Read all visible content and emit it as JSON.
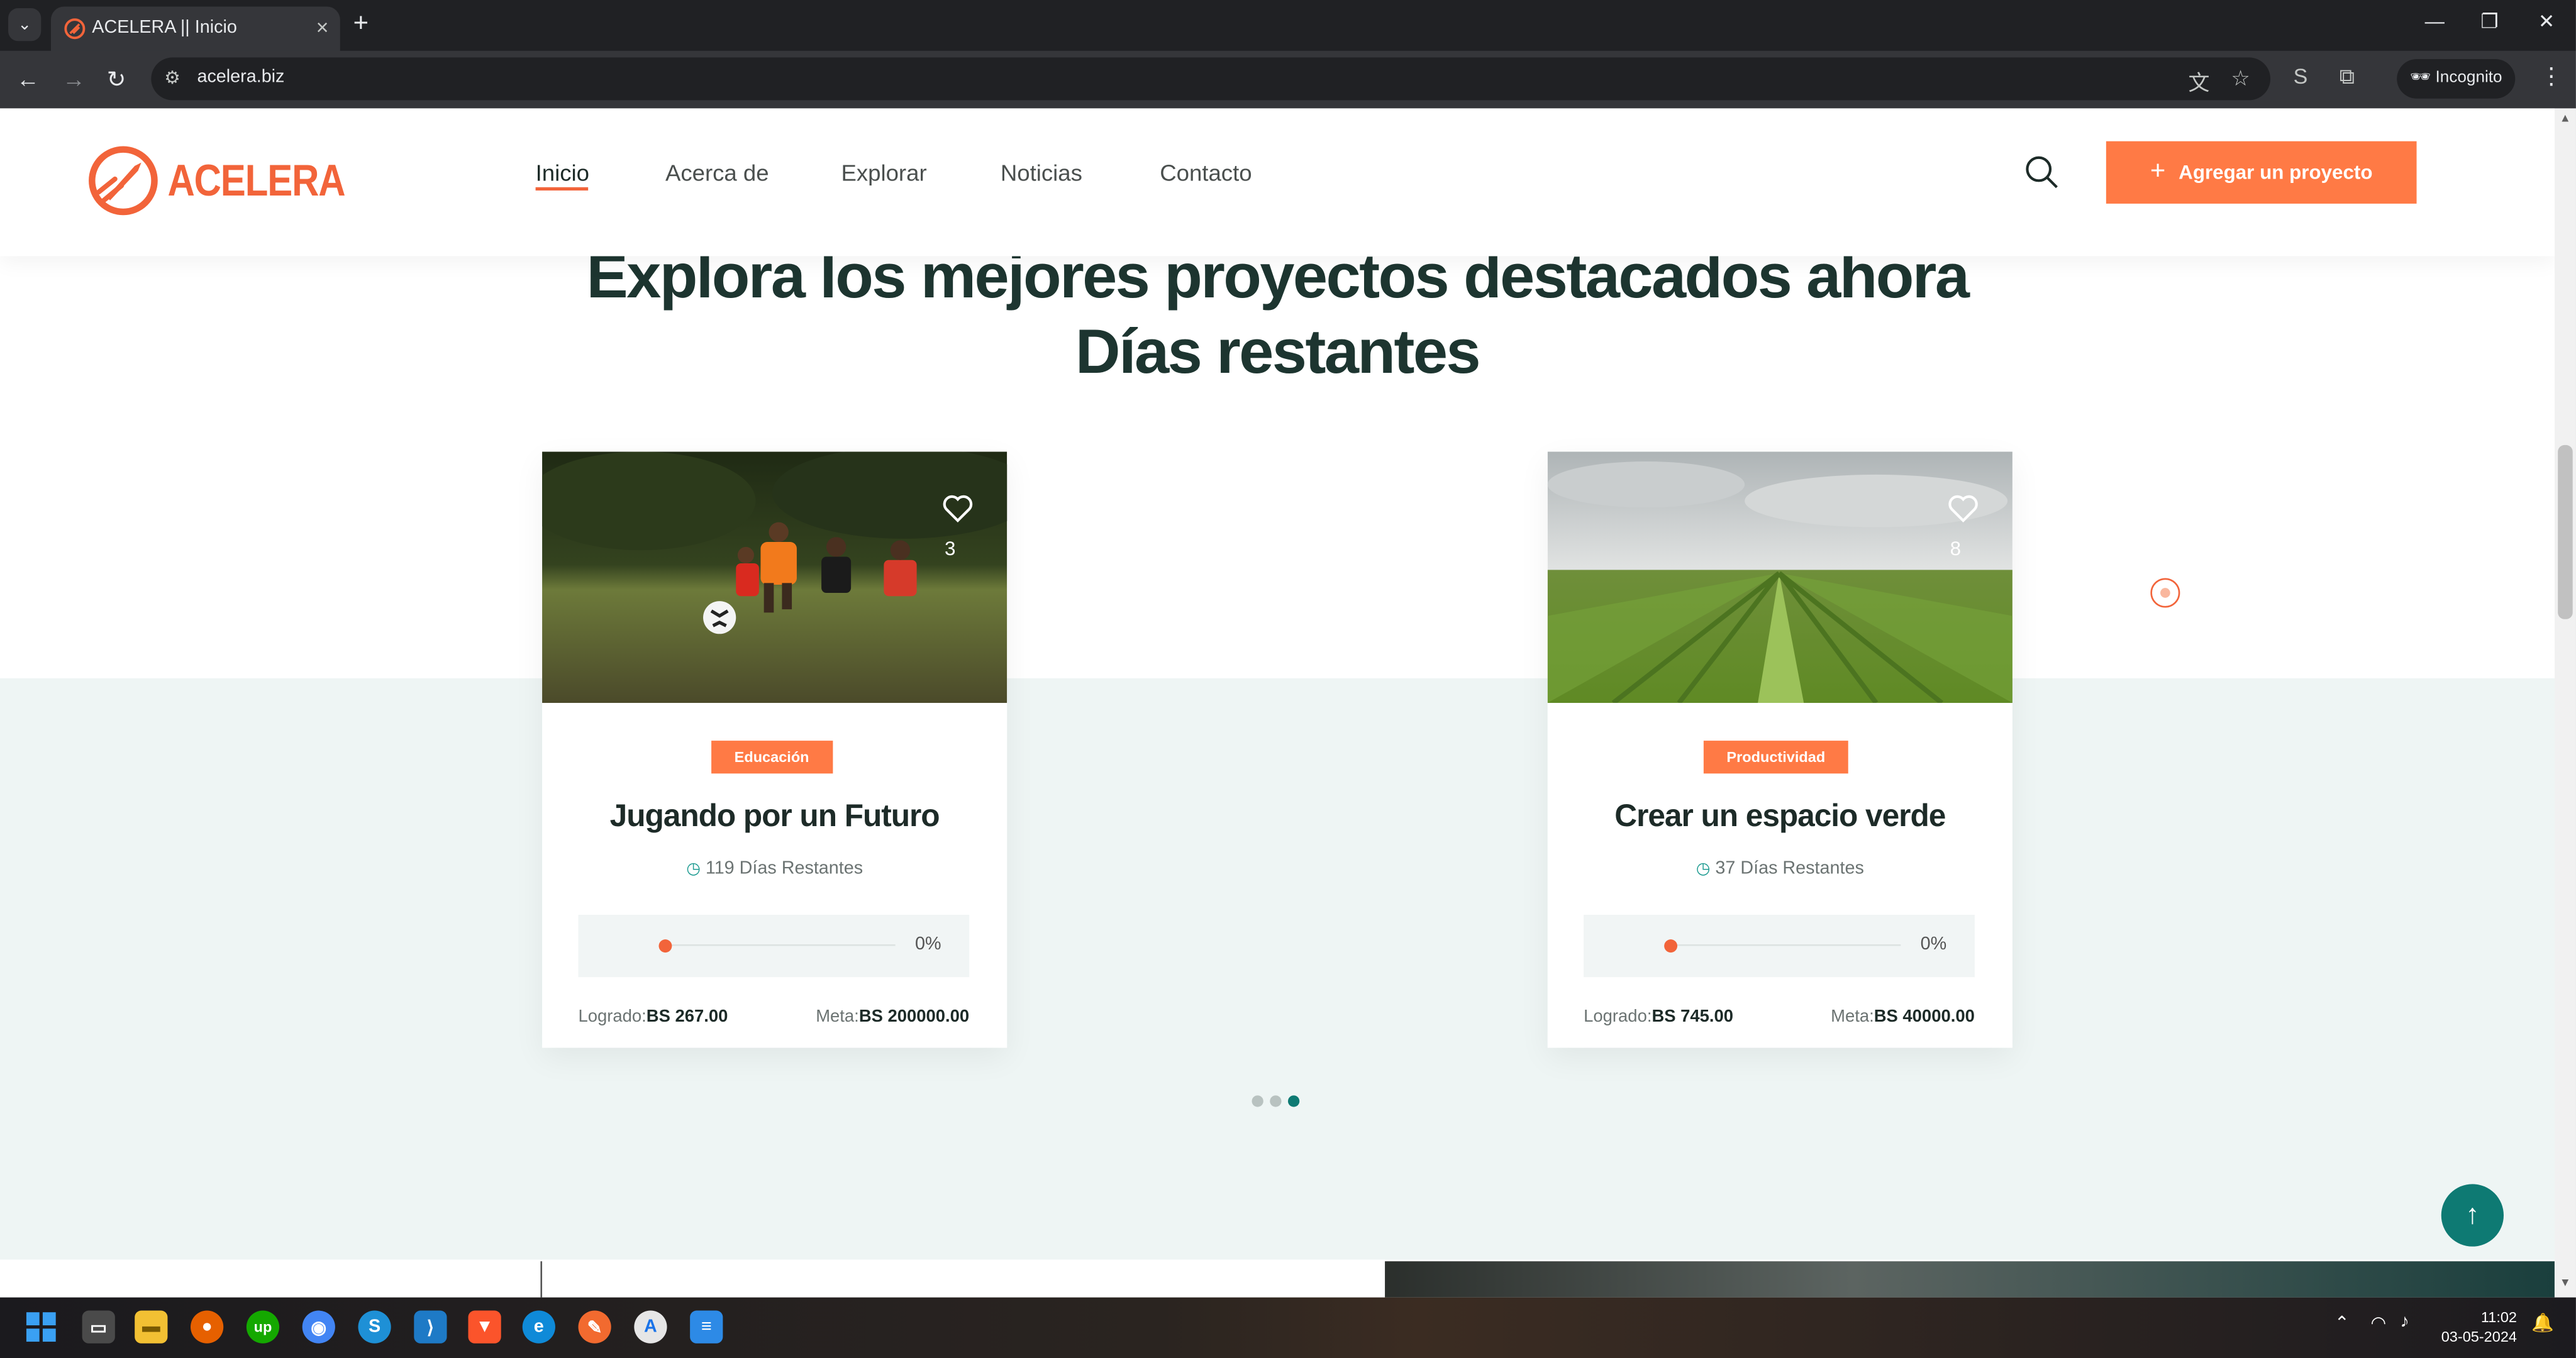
{
  "browser": {
    "tab_title": "ACELERA || Inicio",
    "url": "acelera.biz",
    "incognito_label": "Incognito"
  },
  "header": {
    "logo_text": "ACELERA",
    "nav": [
      "Inicio",
      "Acerca de",
      "Explorar",
      "Noticias",
      "Contacto"
    ],
    "active_nav": "Inicio",
    "cta_label": "Agregar un proyecto"
  },
  "section": {
    "title_line1": "Explora los mejores proyectos destacados ahora",
    "title_line2": "Días restantes"
  },
  "projects": [
    {
      "favorites": "3",
      "category": "Educación",
      "title": "Jugando por un Futuro",
      "days": "119 Días Restantes",
      "progress_label": "0%",
      "progress": 0,
      "achieved_label": "Logrado:",
      "achieved_value": "BS 267.00",
      "goal_label": "Meta:",
      "goal_value": "BS 200000.00"
    },
    {
      "favorites": "8",
      "category": "Productividad",
      "title": "Crear un espacio verde",
      "days": "37 Días Restantes",
      "progress_label": "0%",
      "progress": 0,
      "achieved_label": "Logrado:",
      "achieved_value": "BS 745.00",
      "goal_label": "Meta:",
      "goal_value": "BS 40000.00"
    }
  ],
  "carousel": {
    "pages": 3,
    "active_page": 3
  },
  "taskbar": {
    "time": "11:02",
    "date": "03-05-2024"
  },
  "colors": {
    "brand": "#f2643a",
    "cta": "#ff7a45",
    "teal": "#0e7a73",
    "heading": "#1d3530"
  }
}
